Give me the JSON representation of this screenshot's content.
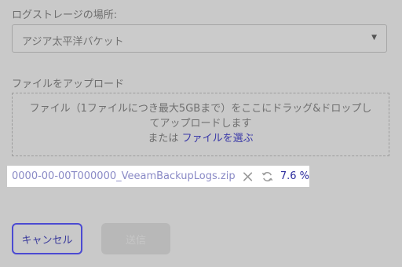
{
  "location": {
    "label": "ログストレージの場所:",
    "selected": "アジア太平洋バケット",
    "arrow_icon": "caret-down-icon"
  },
  "upload": {
    "label": "ファイルをアップロード",
    "drop_line1": "ファイル（1ファイルにつき最大5GBまで）をここにドラッグ&ドロップし",
    "drop_line2": "てアップロードします",
    "drop_or": "または ",
    "choose_link": "ファイルを選ぶ"
  },
  "file": {
    "name": "0000-00-00T000000_VeeamBackupLogs.zip",
    "progress": "7.6 %"
  },
  "buttons": {
    "cancel": "キャンセル",
    "send": "送信"
  }
}
